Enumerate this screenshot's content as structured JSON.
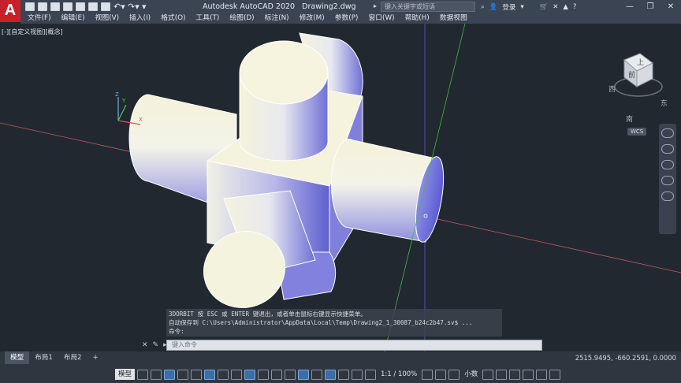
{
  "title": {
    "app_name": "Autodesk AutoCAD 2020",
    "file_name": "Drawing2.dwg",
    "search_placeholder": "键入关键字或短语",
    "login_label": "登录",
    "app_logo": "A"
  },
  "menu": [
    "文件(F)",
    "编辑(E)",
    "视图(V)",
    "插入(I)",
    "格式(O)",
    "工具(T)",
    "绘图(D)",
    "标注(N)",
    "修改(M)",
    "参数(P)",
    "窗口(W)",
    "帮助(H)",
    "数据视图"
  ],
  "viewport": {
    "label": "[-][自定义视图][概念]",
    "ucs_labels": {
      "x": "X",
      "y": "Y",
      "z": "Z"
    }
  },
  "viewcube": {
    "top": "上",
    "front": "前",
    "west": "西",
    "east": "东",
    "south": "南",
    "wcs": "WCS"
  },
  "command": {
    "history": [
      "3DORBIT 按 ESC 或 ENTER 键退出，或者单击鼠标右键显示快捷菜单。",
      "自动保存到 C:\\Users\\Administrator\\AppData\\Local\\Temp\\Drawing2_1_30087_b24c2b47.sv$ ...",
      "命令:"
    ],
    "input_placeholder": "键入命令",
    "close_icon": "close-icon",
    "wrench_icon": "wrench-icon"
  },
  "tabs": [
    {
      "label": "模型",
      "active": true
    },
    {
      "label": "布局1",
      "active": false
    },
    {
      "label": "布局2",
      "active": false
    }
  ],
  "add_tab": "+",
  "coordinates": "2515.9495, -660.2591, 0.0000",
  "status": {
    "model_label": "模型",
    "scale": "1:1 / 100%",
    "units": "小数"
  },
  "colors": {
    "logo": "#c8202a",
    "background": "#212830",
    "solid_light": "#f3f2dc",
    "solid_shade": "#6f6fd8"
  }
}
